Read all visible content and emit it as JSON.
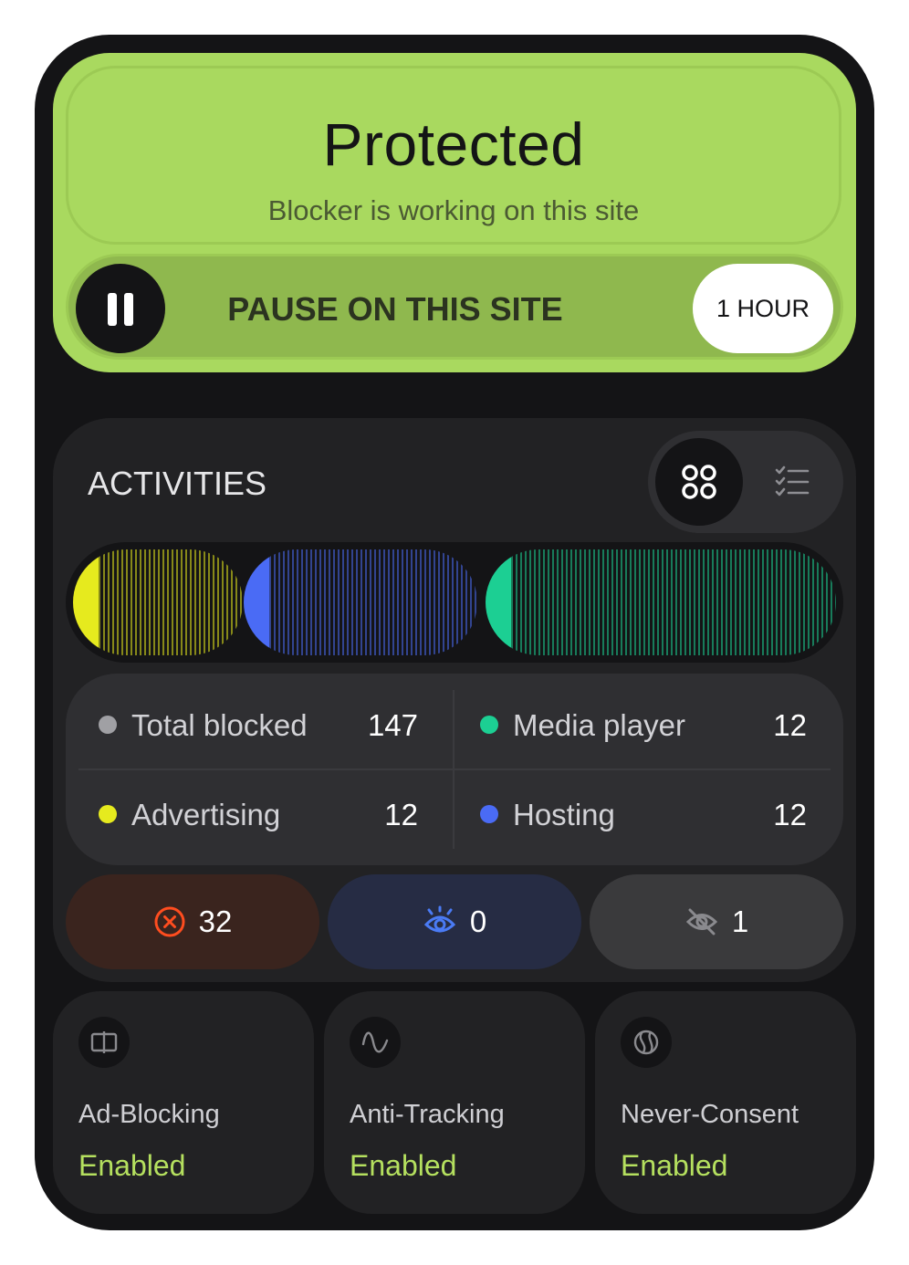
{
  "status": {
    "title": "Protected",
    "subtitle": "Blocker is working on this site",
    "pause_label": "PAUSE ON THIS SITE",
    "pause_duration": "1 HOUR",
    "pause_icon": "pause-icon",
    "accent_color": "#a9d95f"
  },
  "activities": {
    "title": "ACTIVITIES",
    "view_modes": [
      {
        "icon": "grid-icon",
        "active": true
      },
      {
        "icon": "checklist-icon",
        "active": false
      }
    ],
    "category_bar": [
      {
        "category": "Advertising",
        "color": "#e6ea1e"
      },
      {
        "category": "Hosting",
        "color": "#4a6bf5"
      },
      {
        "category": "Media player",
        "color": "#1ccf93"
      }
    ],
    "stats": [
      {
        "label": "Total blocked",
        "value": "147",
        "color": "#a0a0a4"
      },
      {
        "label": "Media player",
        "value": "12",
        "color": "#1ccf93"
      },
      {
        "label": "Advertising",
        "value": "12",
        "color": "#e6ea1e"
      },
      {
        "label": "Hosting",
        "value": "12",
        "color": "#4a6bf5"
      }
    ],
    "counters": [
      {
        "icon": "blocked-x-icon",
        "value": "32",
        "color": "#ff4d1f",
        "bg": "#3a241e"
      },
      {
        "icon": "tracker-eye-icon",
        "value": "0",
        "color": "#4a7bf5",
        "bg": "#262c44"
      },
      {
        "icon": "hidden-eye-icon",
        "value": "1",
        "color": "#8a8a8e",
        "bg": "#3a3a3c"
      }
    ]
  },
  "features": [
    {
      "name": "Ad-Blocking",
      "status": "Enabled",
      "icon": "ad-block-icon"
    },
    {
      "name": "Anti-Tracking",
      "status": "Enabled",
      "icon": "wave-icon"
    },
    {
      "name": "Never-Consent",
      "status": "Enabled",
      "icon": "never-consent-icon"
    }
  ]
}
